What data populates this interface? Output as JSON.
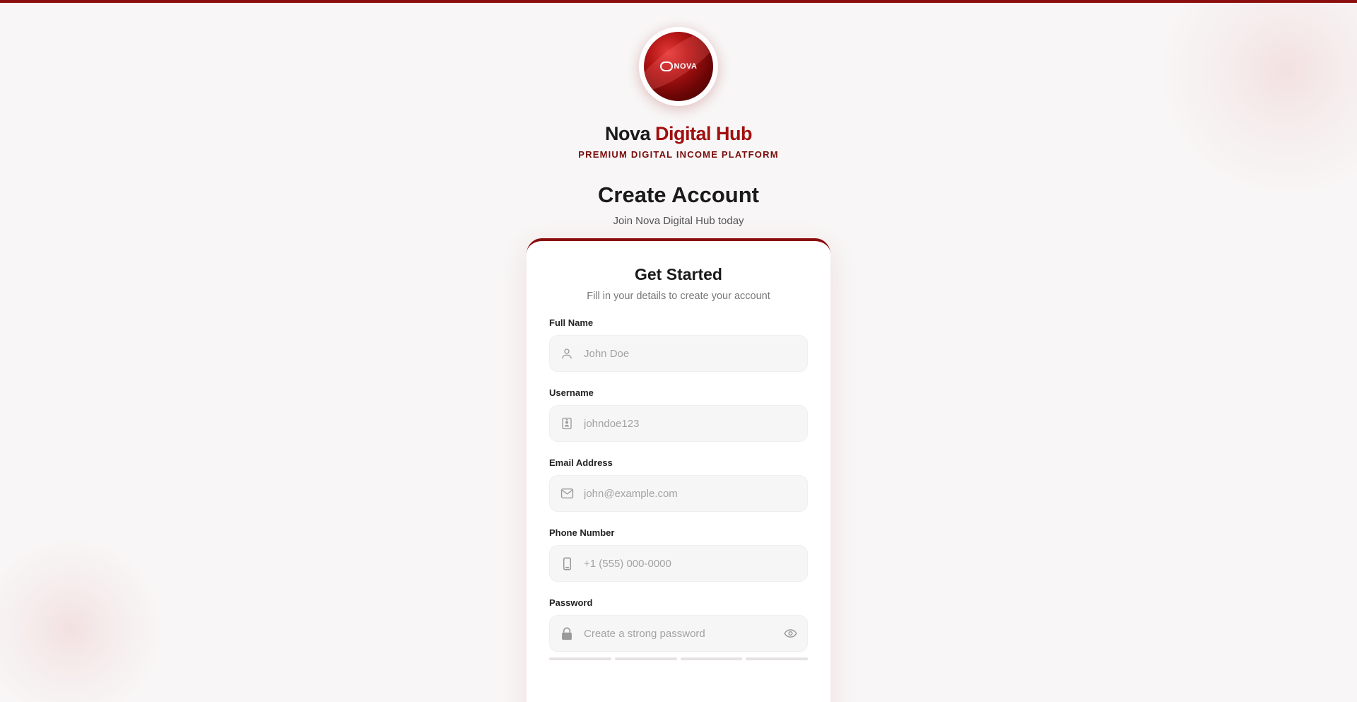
{
  "brand": {
    "logo_text": "NOVA",
    "name_part1": "Nova",
    "name_part2": "Digital Hub",
    "tagline": "PREMIUM DIGITAL INCOME PLATFORM"
  },
  "page": {
    "heading": "Create Account",
    "subheading": "Join Nova Digital Hub today"
  },
  "card": {
    "title": "Get Started",
    "subtitle": "Fill in your details to create your account"
  },
  "fields": {
    "full_name": {
      "label": "Full Name",
      "placeholder": "John Doe",
      "value": "",
      "icon": "user-icon"
    },
    "username": {
      "label": "Username",
      "placeholder": "johndoe123",
      "value": "",
      "icon": "id-badge-icon"
    },
    "email": {
      "label": "Email Address",
      "placeholder": "john@example.com",
      "value": "",
      "icon": "envelope-icon"
    },
    "phone": {
      "label": "Phone Number",
      "placeholder": "+1 (555) 000-0000",
      "value": "",
      "icon": "mobile-phone-icon"
    },
    "password": {
      "label": "Password",
      "placeholder": "Create a strong password",
      "value": "",
      "icon": "lock-icon",
      "toggle_icon": "eye-icon"
    }
  },
  "password_strength": {
    "segments": 4,
    "filled": 0
  },
  "colors": {
    "accent": "#a10f0f",
    "accent_dark": "#8b0d0d",
    "background": "#f8f6f6",
    "input_bg": "#f7f6f6"
  }
}
